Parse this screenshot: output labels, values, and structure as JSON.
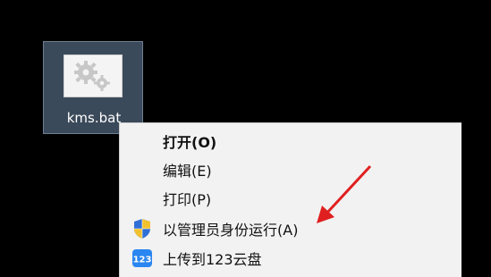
{
  "desktop": {
    "file_icon_name": "gear-file-icon",
    "file_name": "kms.bat"
  },
  "context_menu": {
    "items": [
      {
        "label": "打开(O)",
        "bold": true
      },
      {
        "label": "编辑(E)",
        "bold": false
      },
      {
        "label": "打印(P)",
        "bold": false
      },
      {
        "label": "以管理员身份运行(A)",
        "bold": false,
        "icon": "uac-shield-icon"
      },
      {
        "label": "上传到123云盘",
        "bold": false,
        "icon": "123pan-icon",
        "icon_text": "123"
      }
    ]
  },
  "annotation": {
    "arrow_color": "#e02020"
  }
}
